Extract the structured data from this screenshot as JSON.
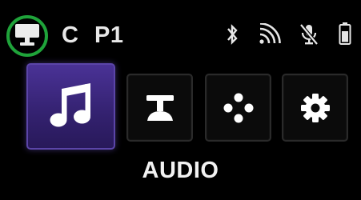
{
  "status_bar": {
    "profile_icon": "monitor-icon",
    "mode_letter": "C",
    "preset_label": "P1",
    "icons": [
      "bluetooth-icon",
      "wireless-signal-icon",
      "microphone-muted-icon",
      "battery-icon"
    ],
    "highlight_color": "#1fa33a"
  },
  "menu": {
    "selected_index": 0,
    "tiles": [
      {
        "name": "audio",
        "icon": "music-note-icon",
        "selected": true
      },
      {
        "name": "stand",
        "icon": "microphone-stand-icon",
        "selected": false
      },
      {
        "name": "controls",
        "icon": "dpad-icon",
        "selected": false
      },
      {
        "name": "settings",
        "icon": "gear-icon",
        "selected": false
      }
    ],
    "selected_color": "#3e2a85"
  },
  "mode_label": "AUDIO"
}
